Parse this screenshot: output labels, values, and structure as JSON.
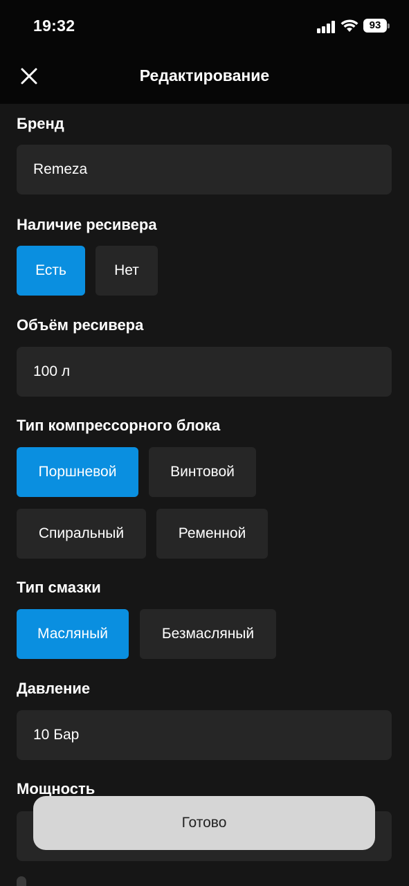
{
  "status_bar": {
    "time": "19:32",
    "battery": "93"
  },
  "header": {
    "title": "Редактирование"
  },
  "brand": {
    "label": "Бренд",
    "value": "Remeza"
  },
  "receiver": {
    "label": "Наличие ресивера",
    "options": [
      "Есть",
      "Нет"
    ],
    "selected": "Есть"
  },
  "receiver_volume": {
    "label": "Объём ресивера",
    "value": "100 л"
  },
  "compressor_type": {
    "label": "Тип компрессорного блока",
    "options": [
      "Поршневой",
      "Винтовой",
      "Спиральный",
      "Ременной"
    ],
    "selected": "Поршневой"
  },
  "lubrication": {
    "label": "Тип смазки",
    "options": [
      "Масляный",
      "Безмасляный"
    ],
    "selected": "Масляный"
  },
  "pressure": {
    "label": "Давление",
    "value": "10 Бар"
  },
  "power": {
    "label": "Мощность"
  },
  "footer": {
    "done_label": "Готово"
  },
  "colors": {
    "accent": "#0a8fe0",
    "background": "#161616",
    "field": "#262626",
    "header": "#060606"
  }
}
